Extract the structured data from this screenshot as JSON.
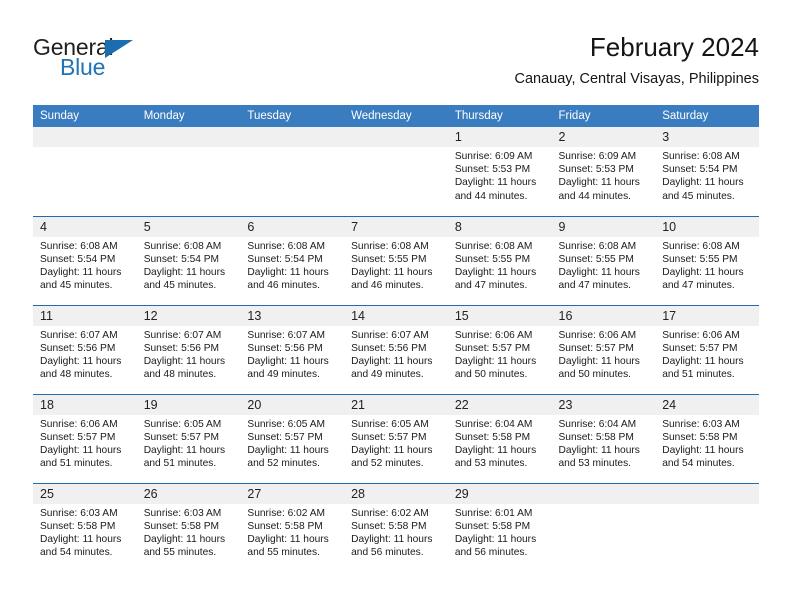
{
  "logo": {
    "word_top": "General",
    "word_bottom": "Blue",
    "accent_color": "#1b6cb0"
  },
  "header": {
    "title": "February 2024",
    "subtitle": "Canauay, Central Visayas, Philippines"
  },
  "calendar": {
    "header_bg": "#3a7cc0",
    "row_divider_color": "#1f6cb0",
    "daynum_bg": "#f0f0f0",
    "weekdays": [
      "Sunday",
      "Monday",
      "Tuesday",
      "Wednesday",
      "Thursday",
      "Friday",
      "Saturday"
    ],
    "labels": {
      "sunrise": "Sunrise:",
      "sunset": "Sunset:",
      "daylight": "Daylight:"
    },
    "weeks": [
      [
        {
          "day": "",
          "sunrise": "",
          "sunset": "",
          "daylight_1": "",
          "daylight_2": ""
        },
        {
          "day": "",
          "sunrise": "",
          "sunset": "",
          "daylight_1": "",
          "daylight_2": ""
        },
        {
          "day": "",
          "sunrise": "",
          "sunset": "",
          "daylight_1": "",
          "daylight_2": ""
        },
        {
          "day": "",
          "sunrise": "",
          "sunset": "",
          "daylight_1": "",
          "daylight_2": ""
        },
        {
          "day": "1",
          "sunrise": "Sunrise: 6:09 AM",
          "sunset": "Sunset: 5:53 PM",
          "daylight_1": "Daylight: 11 hours",
          "daylight_2": "and 44 minutes."
        },
        {
          "day": "2",
          "sunrise": "Sunrise: 6:09 AM",
          "sunset": "Sunset: 5:53 PM",
          "daylight_1": "Daylight: 11 hours",
          "daylight_2": "and 44 minutes."
        },
        {
          "day": "3",
          "sunrise": "Sunrise: 6:08 AM",
          "sunset": "Sunset: 5:54 PM",
          "daylight_1": "Daylight: 11 hours",
          "daylight_2": "and 45 minutes."
        }
      ],
      [
        {
          "day": "4",
          "sunrise": "Sunrise: 6:08 AM",
          "sunset": "Sunset: 5:54 PM",
          "daylight_1": "Daylight: 11 hours",
          "daylight_2": "and 45 minutes."
        },
        {
          "day": "5",
          "sunrise": "Sunrise: 6:08 AM",
          "sunset": "Sunset: 5:54 PM",
          "daylight_1": "Daylight: 11 hours",
          "daylight_2": "and 45 minutes."
        },
        {
          "day": "6",
          "sunrise": "Sunrise: 6:08 AM",
          "sunset": "Sunset: 5:54 PM",
          "daylight_1": "Daylight: 11 hours",
          "daylight_2": "and 46 minutes."
        },
        {
          "day": "7",
          "sunrise": "Sunrise: 6:08 AM",
          "sunset": "Sunset: 5:55 PM",
          "daylight_1": "Daylight: 11 hours",
          "daylight_2": "and 46 minutes."
        },
        {
          "day": "8",
          "sunrise": "Sunrise: 6:08 AM",
          "sunset": "Sunset: 5:55 PM",
          "daylight_1": "Daylight: 11 hours",
          "daylight_2": "and 47 minutes."
        },
        {
          "day": "9",
          "sunrise": "Sunrise: 6:08 AM",
          "sunset": "Sunset: 5:55 PM",
          "daylight_1": "Daylight: 11 hours",
          "daylight_2": "and 47 minutes."
        },
        {
          "day": "10",
          "sunrise": "Sunrise: 6:08 AM",
          "sunset": "Sunset: 5:55 PM",
          "daylight_1": "Daylight: 11 hours",
          "daylight_2": "and 47 minutes."
        }
      ],
      [
        {
          "day": "11",
          "sunrise": "Sunrise: 6:07 AM",
          "sunset": "Sunset: 5:56 PM",
          "daylight_1": "Daylight: 11 hours",
          "daylight_2": "and 48 minutes."
        },
        {
          "day": "12",
          "sunrise": "Sunrise: 6:07 AM",
          "sunset": "Sunset: 5:56 PM",
          "daylight_1": "Daylight: 11 hours",
          "daylight_2": "and 48 minutes."
        },
        {
          "day": "13",
          "sunrise": "Sunrise: 6:07 AM",
          "sunset": "Sunset: 5:56 PM",
          "daylight_1": "Daylight: 11 hours",
          "daylight_2": "and 49 minutes."
        },
        {
          "day": "14",
          "sunrise": "Sunrise: 6:07 AM",
          "sunset": "Sunset: 5:56 PM",
          "daylight_1": "Daylight: 11 hours",
          "daylight_2": "and 49 minutes."
        },
        {
          "day": "15",
          "sunrise": "Sunrise: 6:06 AM",
          "sunset": "Sunset: 5:57 PM",
          "daylight_1": "Daylight: 11 hours",
          "daylight_2": "and 50 minutes."
        },
        {
          "day": "16",
          "sunrise": "Sunrise: 6:06 AM",
          "sunset": "Sunset: 5:57 PM",
          "daylight_1": "Daylight: 11 hours",
          "daylight_2": "and 50 minutes."
        },
        {
          "day": "17",
          "sunrise": "Sunrise: 6:06 AM",
          "sunset": "Sunset: 5:57 PM",
          "daylight_1": "Daylight: 11 hours",
          "daylight_2": "and 51 minutes."
        }
      ],
      [
        {
          "day": "18",
          "sunrise": "Sunrise: 6:06 AM",
          "sunset": "Sunset: 5:57 PM",
          "daylight_1": "Daylight: 11 hours",
          "daylight_2": "and 51 minutes."
        },
        {
          "day": "19",
          "sunrise": "Sunrise: 6:05 AM",
          "sunset": "Sunset: 5:57 PM",
          "daylight_1": "Daylight: 11 hours",
          "daylight_2": "and 51 minutes."
        },
        {
          "day": "20",
          "sunrise": "Sunrise: 6:05 AM",
          "sunset": "Sunset: 5:57 PM",
          "daylight_1": "Daylight: 11 hours",
          "daylight_2": "and 52 minutes."
        },
        {
          "day": "21",
          "sunrise": "Sunrise: 6:05 AM",
          "sunset": "Sunset: 5:57 PM",
          "daylight_1": "Daylight: 11 hours",
          "daylight_2": "and 52 minutes."
        },
        {
          "day": "22",
          "sunrise": "Sunrise: 6:04 AM",
          "sunset": "Sunset: 5:58 PM",
          "daylight_1": "Daylight: 11 hours",
          "daylight_2": "and 53 minutes."
        },
        {
          "day": "23",
          "sunrise": "Sunrise: 6:04 AM",
          "sunset": "Sunset: 5:58 PM",
          "daylight_1": "Daylight: 11 hours",
          "daylight_2": "and 53 minutes."
        },
        {
          "day": "24",
          "sunrise": "Sunrise: 6:03 AM",
          "sunset": "Sunset: 5:58 PM",
          "daylight_1": "Daylight: 11 hours",
          "daylight_2": "and 54 minutes."
        }
      ],
      [
        {
          "day": "25",
          "sunrise": "Sunrise: 6:03 AM",
          "sunset": "Sunset: 5:58 PM",
          "daylight_1": "Daylight: 11 hours",
          "daylight_2": "and 54 minutes."
        },
        {
          "day": "26",
          "sunrise": "Sunrise: 6:03 AM",
          "sunset": "Sunset: 5:58 PM",
          "daylight_1": "Daylight: 11 hours",
          "daylight_2": "and 55 minutes."
        },
        {
          "day": "27",
          "sunrise": "Sunrise: 6:02 AM",
          "sunset": "Sunset: 5:58 PM",
          "daylight_1": "Daylight: 11 hours",
          "daylight_2": "and 55 minutes."
        },
        {
          "day": "28",
          "sunrise": "Sunrise: 6:02 AM",
          "sunset": "Sunset: 5:58 PM",
          "daylight_1": "Daylight: 11 hours",
          "daylight_2": "and 56 minutes."
        },
        {
          "day": "29",
          "sunrise": "Sunrise: 6:01 AM",
          "sunset": "Sunset: 5:58 PM",
          "daylight_1": "Daylight: 11 hours",
          "daylight_2": "and 56 minutes."
        },
        {
          "day": "",
          "sunrise": "",
          "sunset": "",
          "daylight_1": "",
          "daylight_2": ""
        },
        {
          "day": "",
          "sunrise": "",
          "sunset": "",
          "daylight_1": "",
          "daylight_2": ""
        }
      ]
    ]
  }
}
